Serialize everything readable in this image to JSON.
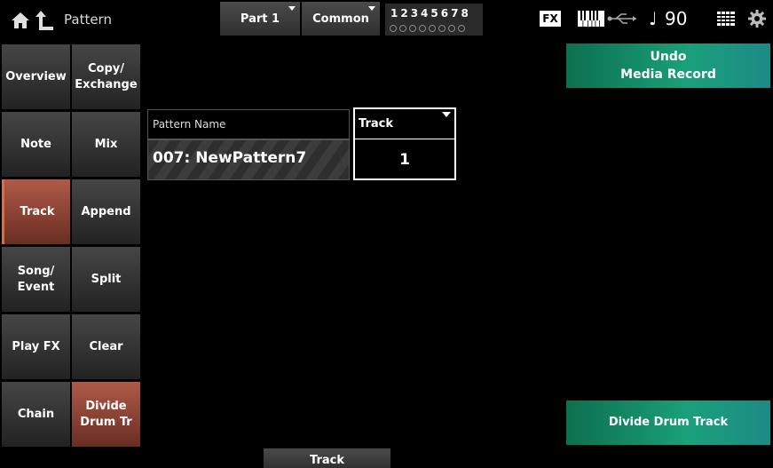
{
  "header": {
    "title": "Pattern",
    "part_label": "Part 1",
    "common_label": "Common",
    "part_numbers": "12345678",
    "fx_label": "FX",
    "note_symbol": "♩",
    "tempo": "90"
  },
  "sidebar": {
    "col1": [
      "Overview",
      "Note",
      "Track",
      "Song/\nEvent",
      "Play FX",
      "Chain"
    ],
    "col2": [
      "Copy/\nExchange",
      "Mix",
      "Append",
      "Split",
      "Clear",
      "Divide\nDrum Tr"
    ]
  },
  "main": {
    "pattern_name_label": "Pattern Name",
    "pattern_name_value": "007: NewPattern7",
    "track_label": "Track",
    "track_value": "1"
  },
  "buttons": {
    "undo_line1": "Undo",
    "undo_line2": "Media Record",
    "divide": "Divide Drum Track"
  },
  "bottom_tab": "Track",
  "colors": {
    "accent_green": "#1aa07a",
    "active_tab": "#b05a48"
  }
}
